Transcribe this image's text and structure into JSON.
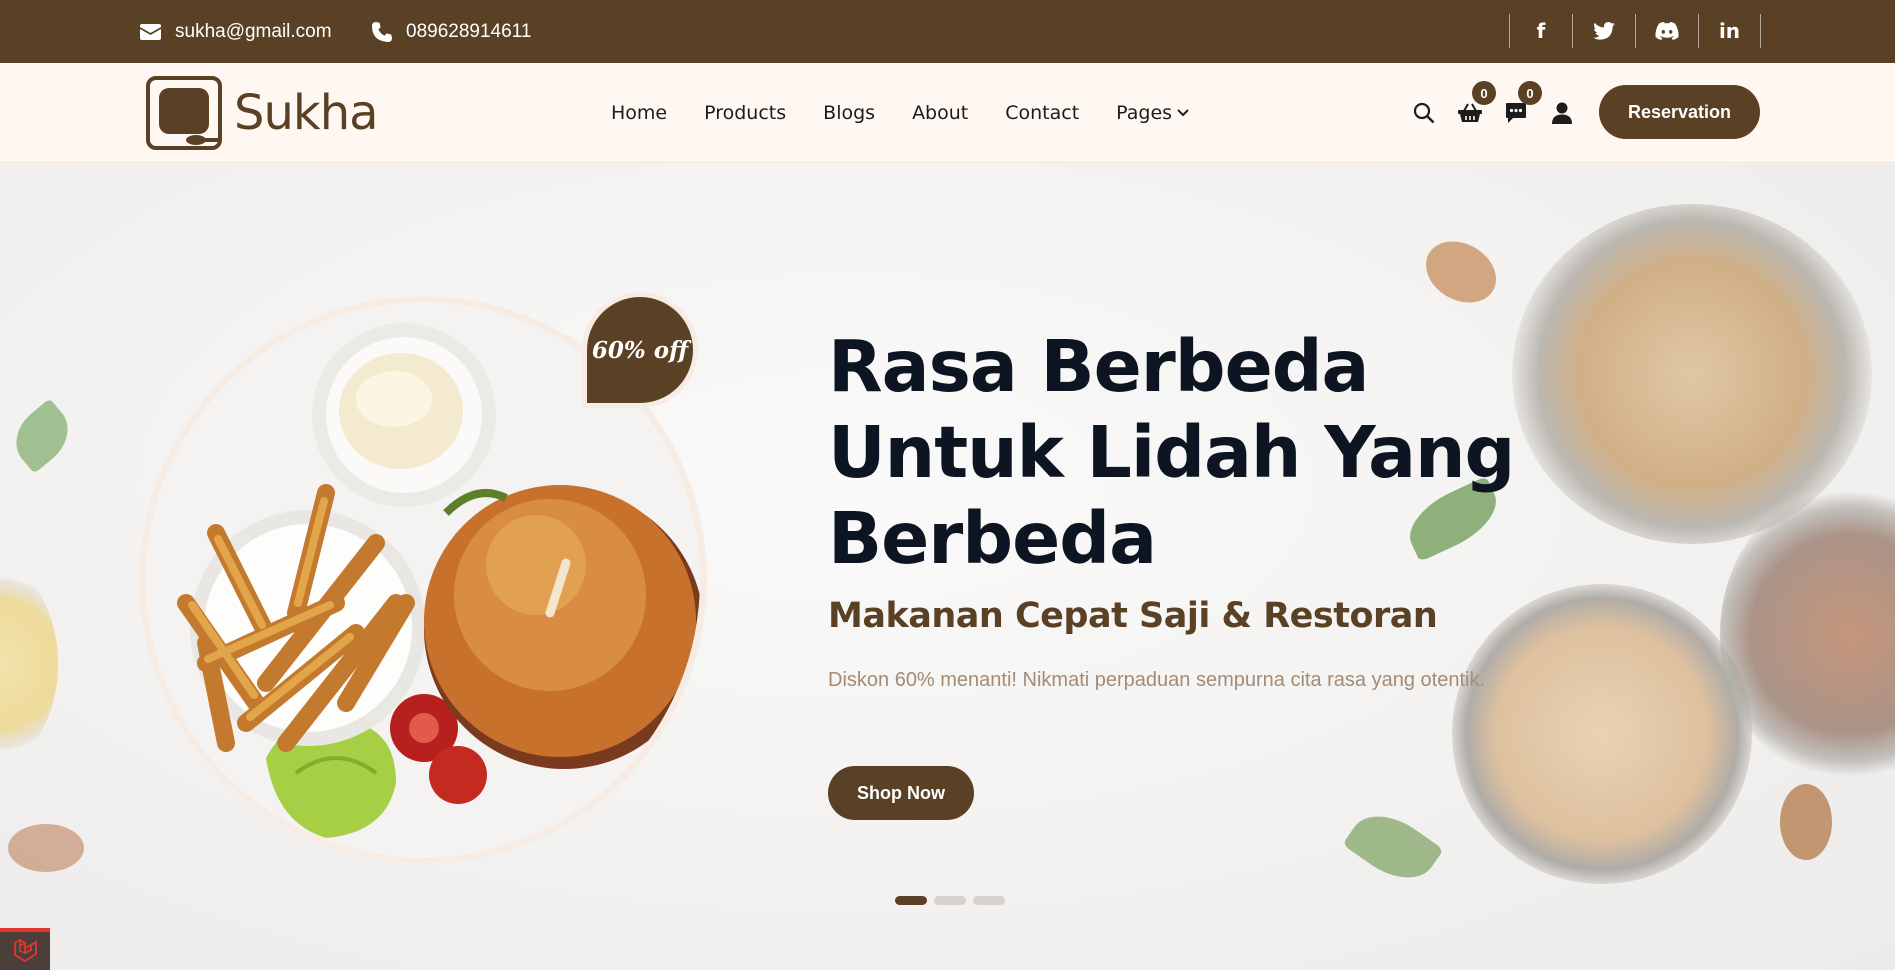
{
  "topbar": {
    "email": "sukha@gmail.com",
    "phone": "089628914611",
    "socials": [
      {
        "icon": "facebook-icon",
        "glyph": "f"
      },
      {
        "icon": "twitter-icon",
        "glyph": ""
      },
      {
        "icon": "discord-icon",
        "glyph": ""
      },
      {
        "icon": "linkedin-icon",
        "glyph": "in"
      }
    ]
  },
  "nav": {
    "brand": "Sukha",
    "items": [
      "Home",
      "Products",
      "Blogs",
      "About",
      "Contact",
      "Pages"
    ],
    "cart_count": "0",
    "chat_count": "0",
    "reservation_label": "Reservation"
  },
  "hero": {
    "badge": "60% off",
    "title": "Rasa Berbeda Untuk Lidah Yang Berbeda",
    "subtitle": "Makanan Cepat Saji & Restoran",
    "description": "Diskon 60% menanti! Nikmati perpaduan sempurna cita rasa yang otentik.",
    "cta_label": "Shop Now",
    "slides": 3,
    "active_slide": 1
  },
  "colors": {
    "brand": "#5a4024",
    "heading": "#0d1522",
    "muted": "#a58b76",
    "nav_bg": "#fff8f2"
  }
}
